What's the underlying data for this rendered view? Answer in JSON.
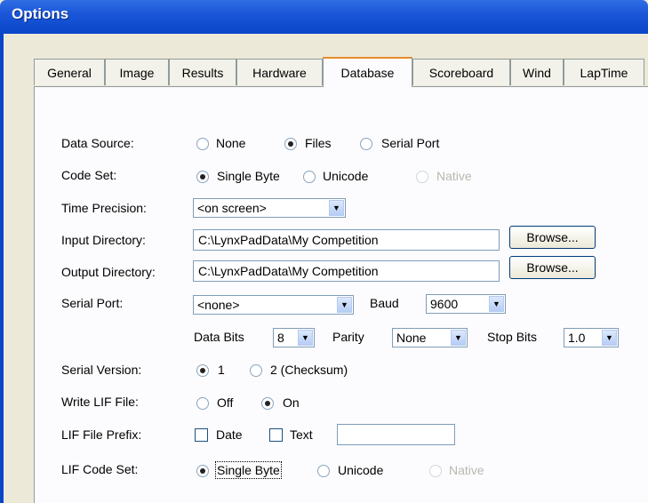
{
  "window": {
    "title": "Options"
  },
  "tabs": [
    "General",
    "Image",
    "Results",
    "Hardware",
    "Database",
    "Scoreboard",
    "Wind",
    "LapTime"
  ],
  "active_tab": "Database",
  "form": {
    "data_source": {
      "label": "Data Source:",
      "options": [
        "None",
        "Files",
        "Serial Port"
      ],
      "selected": "Files"
    },
    "code_set": {
      "label": "Code Set:",
      "options": [
        "Single Byte",
        "Unicode",
        "Native"
      ],
      "selected": "Single Byte",
      "disabled": [
        "Native"
      ]
    },
    "time_precision": {
      "label": "Time Precision:",
      "value": "<on screen>"
    },
    "input_directory": {
      "label": "Input Directory:",
      "value": "C:\\LynxPadData\\My Competition",
      "browse": "Browse..."
    },
    "output_directory": {
      "label": "Output Directory:",
      "value": "C:\\LynxPadData\\My Competition",
      "browse": "Browse..."
    },
    "serial_port": {
      "label": "Serial Port:",
      "value": "<none>",
      "baud_label": "Baud",
      "baud_value": "9600"
    },
    "data_bits": {
      "label": "Data Bits",
      "value": "8"
    },
    "parity": {
      "label": "Parity",
      "value": "None"
    },
    "stop_bits": {
      "label": "Stop Bits",
      "value": "1.0"
    },
    "serial_version": {
      "label": "Serial Version:",
      "options": [
        "1",
        "2 (Checksum)"
      ],
      "selected": "1"
    },
    "write_lif": {
      "label": "Write LIF File:",
      "options": [
        "Off",
        "On"
      ],
      "selected": "On"
    },
    "lif_prefix": {
      "label": "LIF File Prefix:",
      "date_label": "Date",
      "text_label": "Text",
      "text_value": ""
    },
    "lif_code_set": {
      "label": "LIF Code Set:",
      "options": [
        "Single Byte",
        "Unicode",
        "Native"
      ],
      "selected": "Single Byte",
      "disabled": [
        "Native"
      ]
    }
  }
}
